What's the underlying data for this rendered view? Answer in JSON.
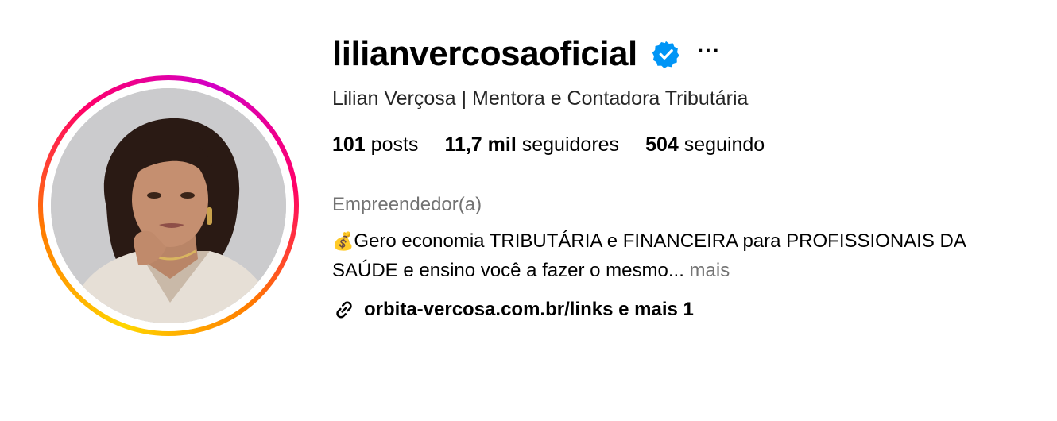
{
  "profile": {
    "username": "lilianvercosaoficial",
    "verified": true,
    "more_options": "···",
    "full_name": "Lilian Verçosa | Mentora e Contadora Tributária",
    "stats": {
      "posts_count": "101",
      "posts_label": "posts",
      "followers_count": "11,7 mil",
      "followers_label": "seguidores",
      "following_count": "504",
      "following_label": "seguindo"
    },
    "category": "Empreendedor(a)",
    "bio": {
      "emoji": "💰",
      "text": "Gero economia TRIBUTÁRIA e FINANCEIRA para PROFISSIONAIS DA SAÚDE e ensino você a fazer o mesmo...",
      "more_label": "mais"
    },
    "link": {
      "text": "orbita-vercosa.com.br/links e mais 1",
      "icon": "link-icon"
    }
  },
  "colors": {
    "verified_blue": "#0095f6",
    "secondary_text": "#737373",
    "ring_gradient": [
      "#ffd600",
      "#ff7a00",
      "#ff0069",
      "#d300c5"
    ]
  }
}
